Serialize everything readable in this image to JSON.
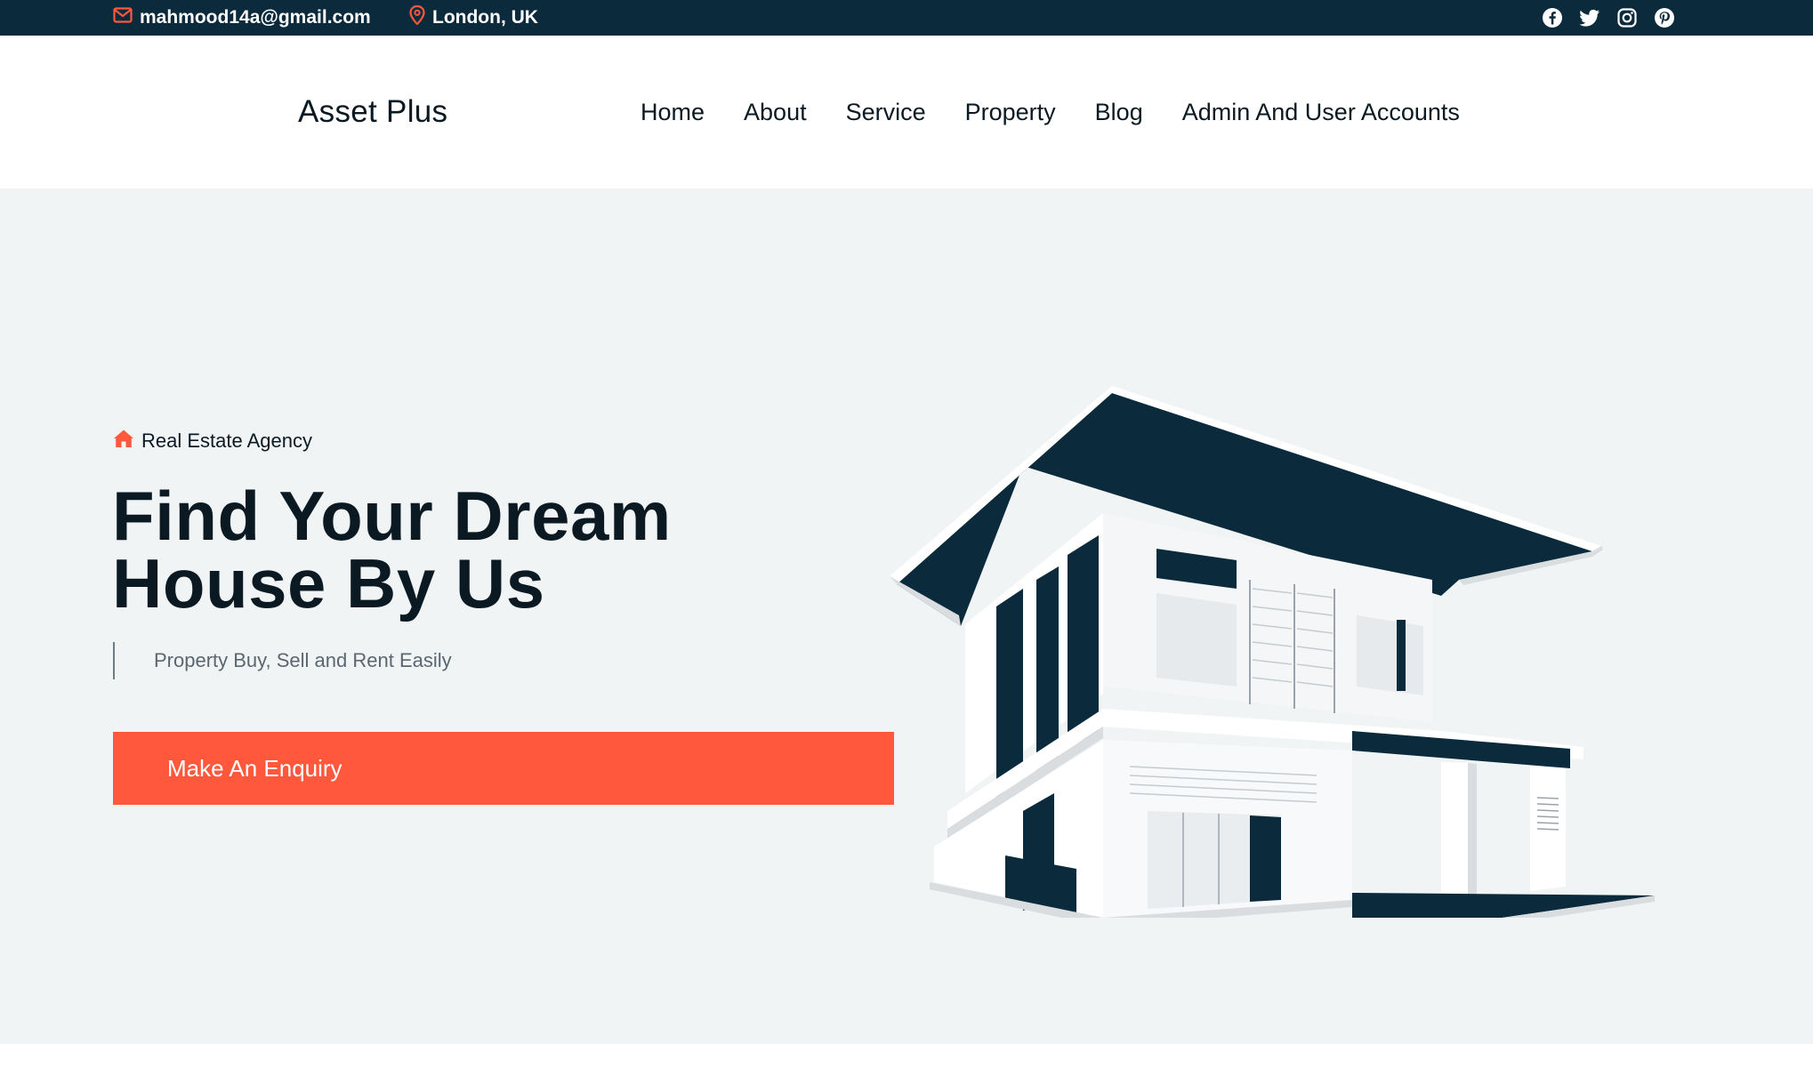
{
  "topbar": {
    "email": "mahmood14a@gmail.com",
    "location": "London, UK",
    "social_icons": [
      "facebook-icon",
      "twitter-icon",
      "instagram-icon",
      "pinterest-icon"
    ]
  },
  "header": {
    "brand": "Asset Plus",
    "nav": [
      "Home",
      "About",
      "Service",
      "Property",
      "Blog",
      "Admin And User Accounts"
    ]
  },
  "hero": {
    "tagline": "Real Estate Agency",
    "headline_line1": "Find Your Dream",
    "headline_line2": "House By Us",
    "subtitle": "Property Buy, Sell and Rent Easily",
    "cta": "Make An Enquiry"
  },
  "colors": {
    "dark": "#0b2a3c",
    "accent": "#ff583c",
    "hero_bg": "#f1f4f5"
  }
}
